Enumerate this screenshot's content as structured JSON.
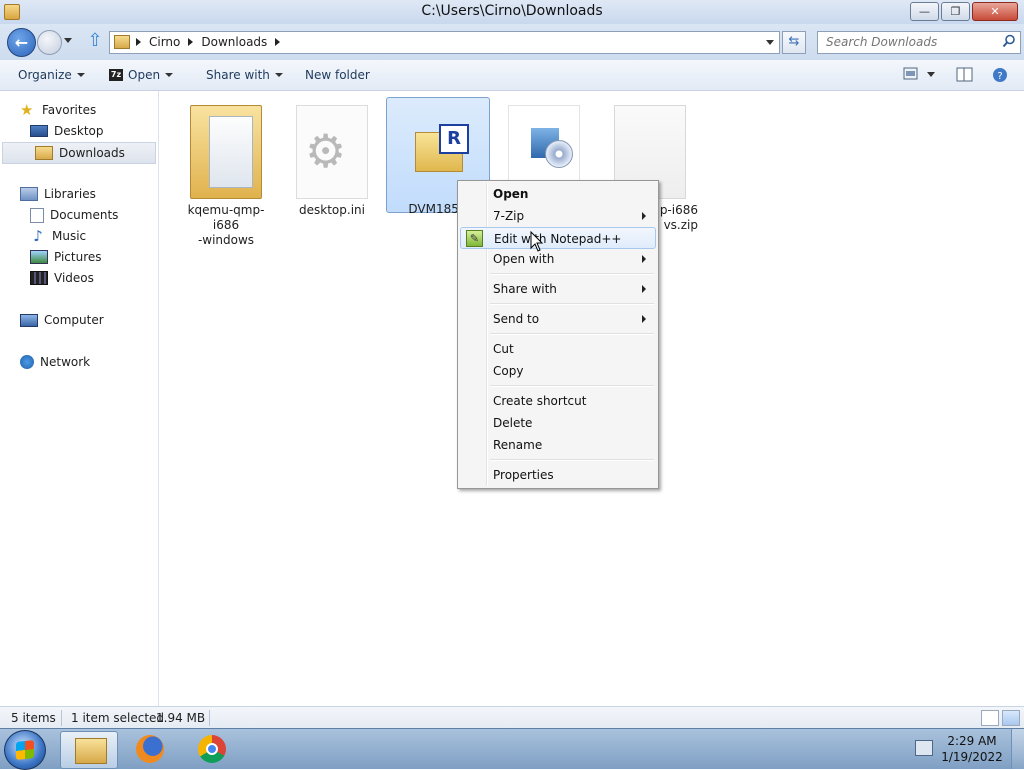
{
  "window": {
    "title": "C:\\Users\\Cirno\\Downloads",
    "minimize_glyph": "—",
    "maximize_glyph": "❐",
    "close_glyph": "✕"
  },
  "navbar": {
    "back_glyph": "←",
    "up_glyph": "⇧",
    "refresh_glyph": "⇆",
    "breadcrumb": [
      "Cirno",
      "Downloads"
    ],
    "search_placeholder": "Search Downloads"
  },
  "toolbar": {
    "organize": "Organize",
    "open_icon_text": "7z",
    "open": "Open",
    "share_with": "Share with",
    "new_folder": "New folder",
    "help_glyph": "?"
  },
  "nav_pane": {
    "favorites": "Favorites",
    "desktop": "Desktop",
    "downloads": "Downloads",
    "libraries": "Libraries",
    "documents": "Documents",
    "music": "Music",
    "pictures": "Pictures",
    "videos": "Videos",
    "computer": "Computer",
    "network": "Network",
    "star_glyph": "★",
    "note_glyph": "♪"
  },
  "files": [
    {
      "line1": "kqemu-qmp-i686",
      "line2": "-windows"
    },
    {
      "line1": "desktop.ini",
      "line2": ""
    },
    {
      "line1": "DVM185.r",
      "line2": ""
    },
    {
      "line1": "",
      "line2": ""
    },
    {
      "line1": "mp-i686",
      "line2": "vs.zip"
    }
  ],
  "reg_letter": "R",
  "context_menu": {
    "open": "Open",
    "seven_zip": "7-Zip",
    "edit_notepad": "Edit with Notepad++",
    "open_with": "Open with",
    "share_with": "Share with",
    "send_to": "Send to",
    "cut": "Cut",
    "copy": "Copy",
    "create_shortcut": "Create shortcut",
    "delete": "Delete",
    "rename": "Rename",
    "properties": "Properties"
  },
  "status": {
    "items": "5 items",
    "selected": "1 item selected",
    "size": "1.94 MB"
  },
  "taskbar": {
    "time": "2:29 AM",
    "date": "1/19/2022"
  },
  "colors": {
    "selection": "#c1dcfc",
    "menu_highlight": "#e0ecfb",
    "taskbar": "#7f9fc3"
  }
}
